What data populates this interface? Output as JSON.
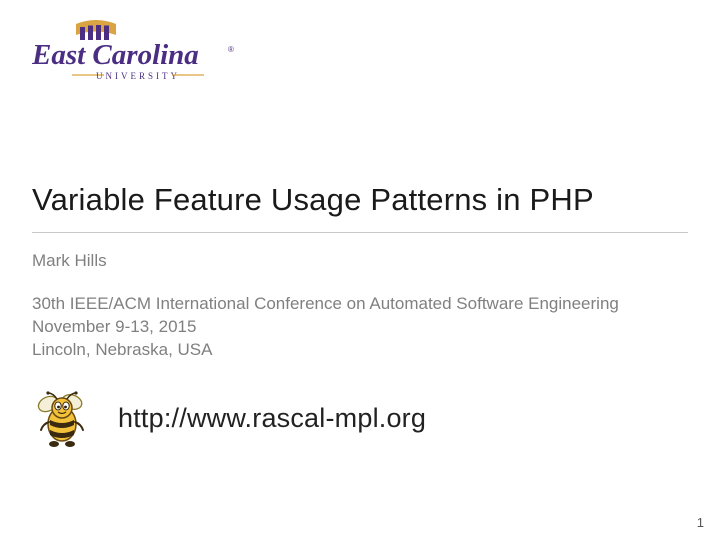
{
  "logo": {
    "line1": "East Carolina",
    "line2": "UNIVERSITY",
    "purple": "#4b2e83",
    "gold": "#d9a441"
  },
  "title": "Variable Feature Usage Patterns in PHP",
  "author": "Mark Hills",
  "conference": "30th IEEE/ACM International Conference on Automated Software Engineering",
  "dates": "November 9-13, 2015",
  "location": "Lincoln, Nebraska, USA",
  "url": "http://www.rascal-mpl.org",
  "page": "1"
}
